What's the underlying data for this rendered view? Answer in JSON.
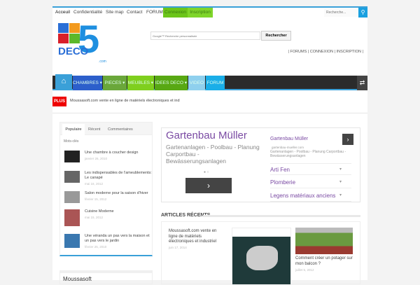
{
  "topbar": {
    "items": [
      "Acceuil",
      "Confidentialité",
      "Site map",
      "Contact",
      "FORUM"
    ],
    "connexion": "Connexion",
    "inscription": "Inscription",
    "search_placeholder": "Recherche..."
  },
  "logo": {
    "text": "DECO",
    "number": "5",
    "suffix": ".com"
  },
  "google_search": {
    "placeholder": "Google™ Recherche personnalisée",
    "button": "Rechercher"
  },
  "header_links": "| FORUMS | CONNEXION | INSCRIPTION |",
  "nav": {
    "items": [
      "CHAMBRES",
      "PIECES",
      "MEUBLES",
      "IDEES DECO",
      "VIDEO",
      "FORUM"
    ],
    "colors": [
      "#2c5fcb",
      "#6aa73a",
      "#7fcf1e",
      "#58a813",
      "#8fd0ee",
      "#1aaee8"
    ]
  },
  "ticker": {
    "label": "PLUS",
    "text": "Moussasoft.com vente en ligne de matériels électroniques et ind"
  },
  "sidebar": {
    "tabs": [
      "Populaire",
      "Récent",
      "Commentaires"
    ],
    "keywords_label": "Mots-clés",
    "posts": [
      {
        "title": "Une chambre à coucher design",
        "date": "janvier 26, 2010"
      },
      {
        "title": "Les indispensables de l'ameublements: Le canapé",
        "date": "mai 16, 2012"
      },
      {
        "title": "Salon moderne pour la saison d'hiver",
        "date": "février 15, 2012"
      },
      {
        "title": "Cuisine Moderne",
        "date": "mai 15, 2012"
      },
      {
        "title": "Une véranda un pas vers la maison et un pas vers le jardin",
        "date": "février 25, 2010"
      }
    ],
    "box2_title": "Moussasoft"
  },
  "ad": {
    "title": "Gartenbau Müller",
    "desc": "Gartenanlagen - Poolbau - Planung Carportbau - Bewässerungsanlagen",
    "small_title": "Gartenbau Müller",
    "url": "gartenbau-mueller.com",
    "small_desc": "Gartenanlagen - Poolbau - Planung Carportbau - Bewässerungsanlagen",
    "links": [
      "Arti Fen",
      "Plomberie",
      "Legens matériaux anciens"
    ]
  },
  "articles": {
    "heading": "ARTICLES RÉCENTS",
    "items": [
      {
        "title": "Moussasoft.com vente en ligne de matériels électroniques et industriel",
        "date": "juin 17, 2014"
      },
      {
        "title": "Comment créer un potager sur mon balcon ?",
        "date": "juillet 5, 2012"
      }
    ]
  }
}
